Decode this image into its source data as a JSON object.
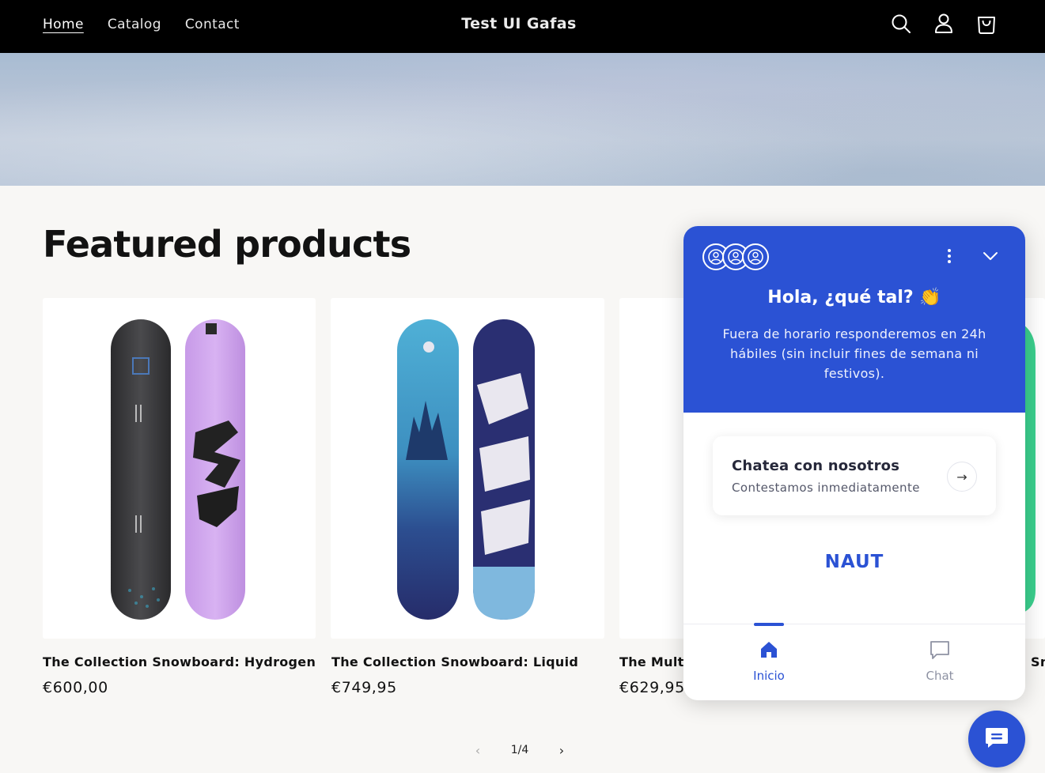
{
  "header": {
    "nav": [
      "Home",
      "Catalog",
      "Contact"
    ],
    "brand": "Test UI Gafas",
    "icons": [
      "search-icon",
      "account-icon",
      "cart-icon"
    ],
    "background": "#000000"
  },
  "section": {
    "title": "Featured products"
  },
  "products": [
    {
      "title": "The Collection Snowboard: Hydrogen",
      "price": "€600,00"
    },
    {
      "title": "The Collection Snowboard: Liquid",
      "price": "€749,95"
    },
    {
      "title": "The Multi-",
      "price": "€629,95"
    },
    {
      "title": "Sn",
      "price": ""
    }
  ],
  "pager": {
    "text": "1/4",
    "prev": "‹",
    "next": "›"
  },
  "widget": {
    "accent": "#2b52d4",
    "greeting": "Hola, ¿qué tal? 👏",
    "subtitle": "Fuera de horario responderemos en 24h hábiles (sin incluir fines de semana ni festivos).",
    "chat_card": {
      "title": "Chatea con nosotros",
      "subtitle": "Contestamos inmediatamente",
      "arrow": "→"
    },
    "logo": "NAUT",
    "tabs": [
      {
        "label": "Inicio",
        "icon": "home-icon",
        "active": true
      },
      {
        "label": "Chat",
        "icon": "chat-icon",
        "active": false
      }
    ]
  },
  "launcher": {
    "icon": "chat-bubble-icon"
  }
}
